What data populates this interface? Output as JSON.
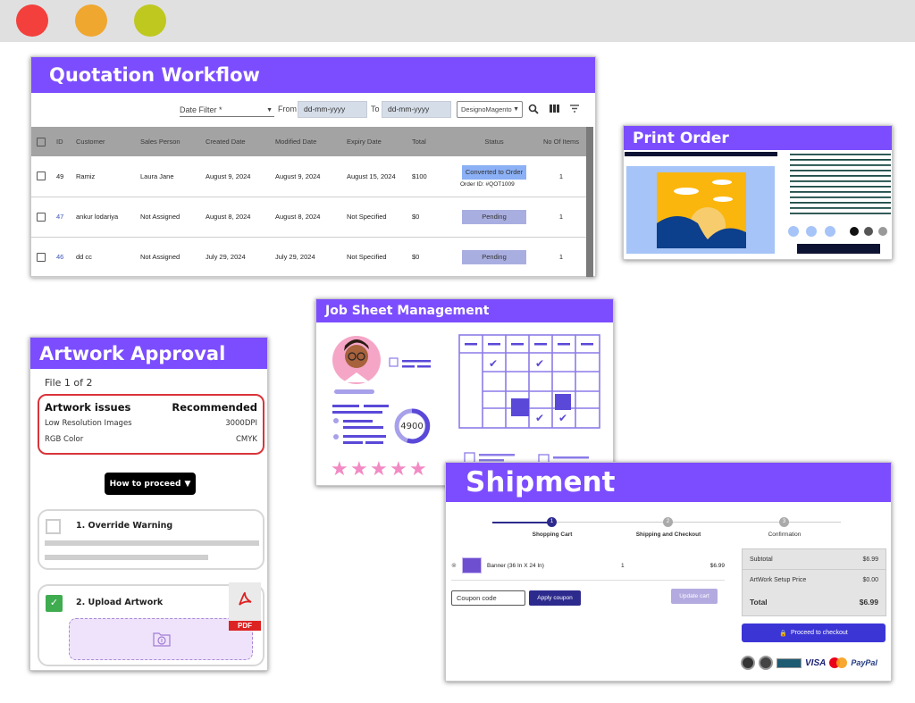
{
  "window": {
    "controls": [
      {
        "name": "close",
        "color": "#f3403c"
      },
      {
        "name": "minimize",
        "color": "#efa72f"
      },
      {
        "name": "maximize",
        "color": "#bec81f"
      }
    ]
  },
  "quotation": {
    "title": "Quotation Workflow",
    "toolbar": {
      "date_filter_label": "Date Filter *",
      "from_label": "From",
      "from_placeholder": "dd-mm-yyyy",
      "to_label": "To",
      "to_placeholder": "dd-mm-yyyy",
      "store_select": "DesignoMagento",
      "icons": [
        "search-icon",
        "columns-icon",
        "filter-icon"
      ]
    },
    "columns": [
      "ID",
      "Customer",
      "Sales Person",
      "Created Date",
      "Modified Date",
      "Expiry Date",
      "Total",
      "Status",
      "No Of Items"
    ],
    "rows": [
      {
        "id": "49",
        "customer": "Ramiz",
        "sales_person": "Laura Jane",
        "created": "August 9, 2024",
        "modified": "August 9, 2024",
        "expiry": "August 15, 2024",
        "total": "$100",
        "status": "Converted to Order",
        "order_id": "Order ID: #QOT1009",
        "items": "1"
      },
      {
        "id": "47",
        "customer": "ankur lodariya",
        "sales_person": "Not Assigned",
        "created": "August 8, 2024",
        "modified": "August 8, 2024",
        "expiry": "Not Specified",
        "total": "$0",
        "status": "Pending",
        "order_id": "",
        "items": "1"
      },
      {
        "id": "46",
        "customer": "dd cc",
        "sales_person": "Not Assigned",
        "created": "July 29, 2024",
        "modified": "July 29, 2024",
        "expiry": "Not Specified",
        "total": "$0",
        "status": "Pending",
        "order_id": "",
        "items": "1"
      }
    ]
  },
  "print_order": {
    "title": "Print Order"
  },
  "artwork": {
    "title": "Artwork Approval",
    "file_counter": "File 1 of 2",
    "issues_header": "Artwork issues",
    "recommended_header": "Recommended",
    "issues": [
      {
        "issue": "Low Resolution Images",
        "recommended": "3000DPI"
      },
      {
        "issue": "RGB Color",
        "recommended": "CMYK"
      }
    ],
    "proceed_button": "How to proceed",
    "options": [
      {
        "label": "1. Override Warning",
        "checked": false
      },
      {
        "label": "2. Upload Artwork",
        "checked": true
      }
    ],
    "file_type_badge": "PDF"
  },
  "job_sheet": {
    "title": "Job Sheet Management",
    "score": "4900",
    "rating": 5
  },
  "shipment": {
    "title": "Shipment",
    "steps": [
      {
        "num": "1",
        "label": "Shopping Cart",
        "active": true
      },
      {
        "num": "2",
        "label": "Shipping and Checkout",
        "active": false
      },
      {
        "num": "3",
        "label": "Confirmation",
        "active": false
      }
    ],
    "cart_item": {
      "name": "Banner (36 In X 24 In)",
      "qty": "1",
      "price": "$6.99"
    },
    "coupon_placeholder": "Coupon code",
    "apply_coupon": "Apply coupon",
    "update_cart": "Update cart",
    "totals": [
      {
        "label": "Subtotal",
        "value": "$6.99"
      },
      {
        "label": "ArtWork Setup Price",
        "value": "$0.00"
      }
    ],
    "total_label": "Total",
    "total_value": "$6.99",
    "checkout_button": "Proceed to checkout",
    "payment_methods": [
      "VISA",
      "PayPal"
    ]
  }
}
